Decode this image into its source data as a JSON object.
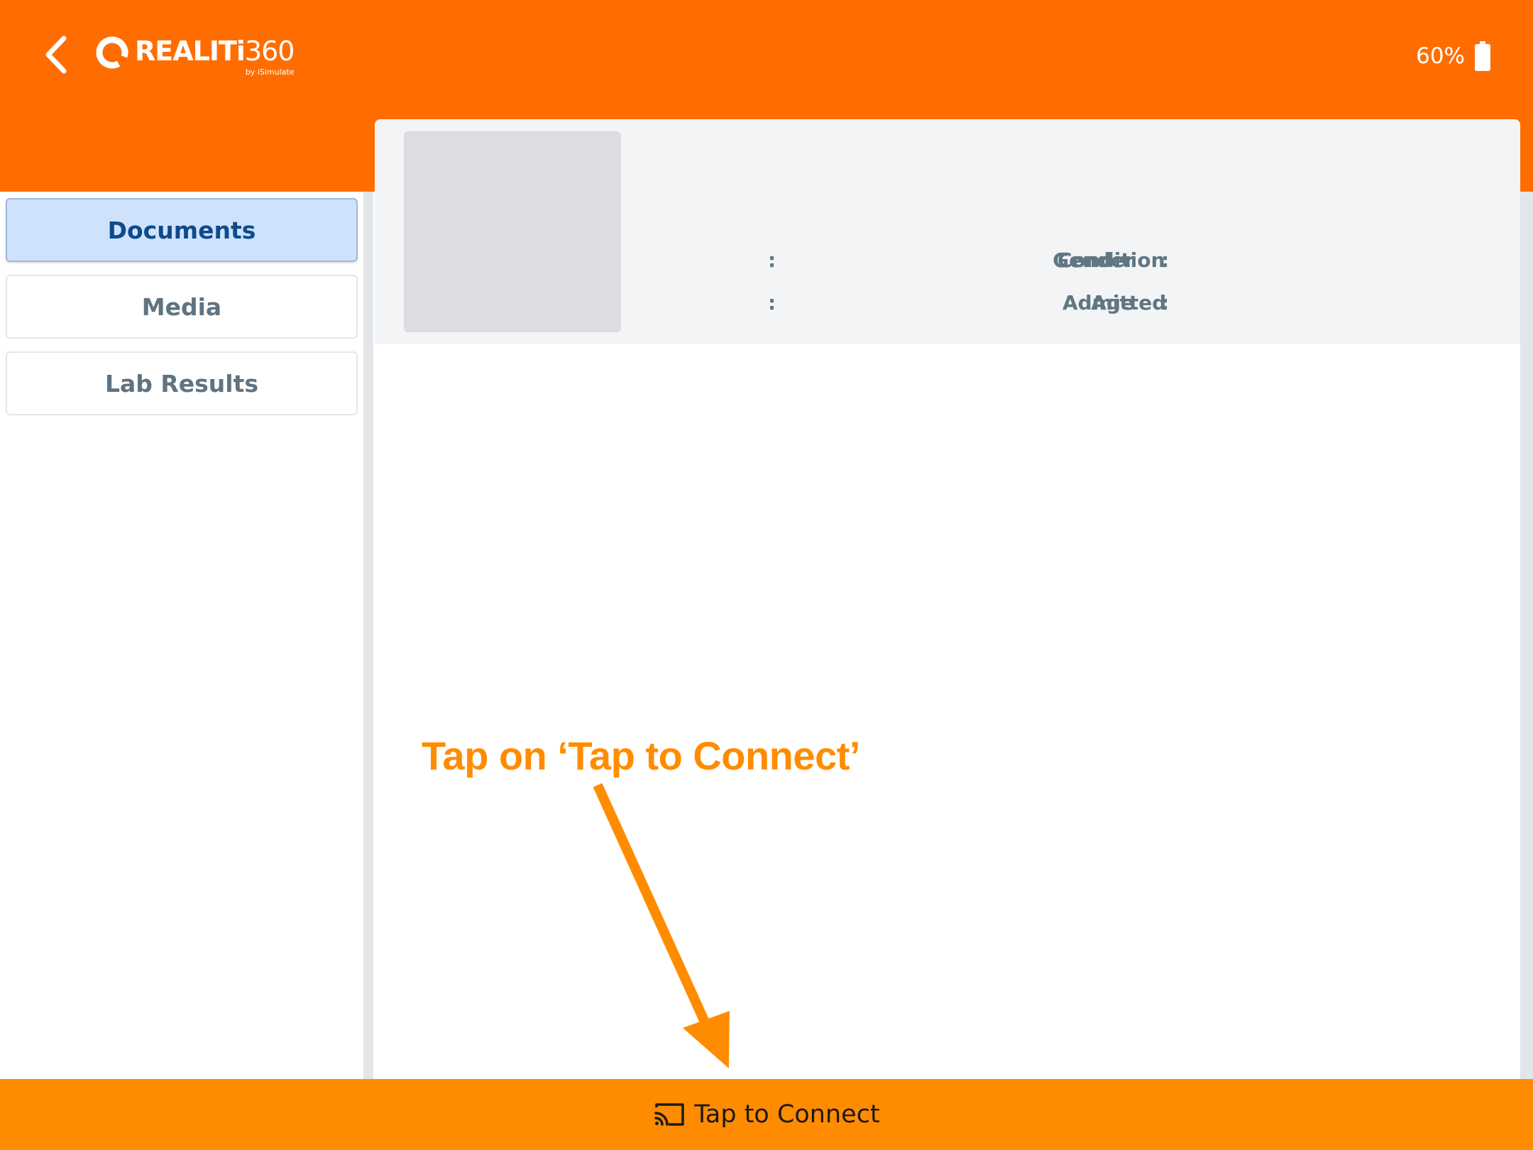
{
  "header": {
    "back_icon": "chevron-left-icon",
    "logo": {
      "bold_part": "REALITi",
      "light_part": "360",
      "subtitle": "by iSimulate"
    },
    "battery": {
      "text": "60%",
      "level": 0.6,
      "icon": "battery-icon"
    },
    "color": "#ff6d00"
  },
  "sidebar": {
    "items": [
      {
        "label": "Documents",
        "active": true
      },
      {
        "label": "Media",
        "active": false
      },
      {
        "label": "Lab Results",
        "active": false
      }
    ]
  },
  "patient": {
    "fields": {
      "gender": {
        "label": "Gender",
        "value": ""
      },
      "age": {
        "label": "Age",
        "value": ""
      },
      "condition": {
        "label": "Condition",
        "value": ""
      },
      "admitted": {
        "label": "Admitted",
        "value": ""
      }
    },
    "separator": ":"
  },
  "annotation": {
    "text": "Tap on ‘Tap to Connect’",
    "color": "#ff8c00"
  },
  "connect_bar": {
    "label": "Tap to Connect",
    "icon": "cast-icon",
    "color": "#ff8c00"
  }
}
